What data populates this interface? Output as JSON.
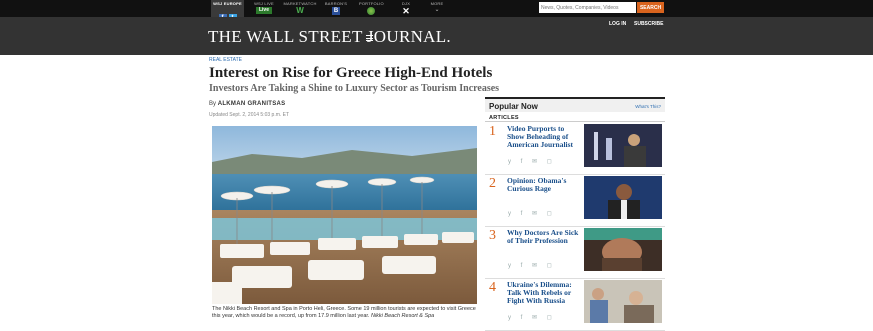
{
  "topnav": {
    "europe_label": "WSJ EUROPE",
    "wsj_live_label": "WSJ LIVE",
    "live_badge": "Live",
    "marketwatch_label": "MARKETWATCH",
    "marketwatch_badge": "W",
    "barrons_label": "BARRON'S",
    "barrons_badge": "B",
    "portfolio_label": "PORTFOLIO",
    "dj_label": "DJX",
    "more_label": "MORE",
    "search_placeholder": "News, Quotes, Companies, Videos",
    "search_button": "SEARCH"
  },
  "masthead": {
    "logo": "THE WALL STREET JOURNAL.",
    "login": "LOG IN",
    "subscribe": "SUBSCRIBE"
  },
  "article": {
    "kicker": "REAL ESTATE",
    "headline": "Interest on Rise for Greece High-End Hotels",
    "subhead": "Investors Are Taking a Shine to Luxury Sector as Tourism Increases",
    "byline_prefix": "By",
    "author": "ALKMAN GRANITSAS",
    "updated": "Updated Sept. 2, 2014 5:03 p.m. ET",
    "caption": "The Nikki Beach Resort and Spa in Porto Heli, Greece. Some 19 million tourists are expected to visit Greece this year, which would be a record, up from 17.9 million last year.",
    "caption_credit": "Nikki Beach Resort & Spa"
  },
  "popular": {
    "title": "Popular Now",
    "whats_this": "What's This?",
    "tab": "ARTICLES",
    "items": [
      {
        "num": "1",
        "text": "Video Purports to Show Beheading of American Journalist"
      },
      {
        "num": "2",
        "text": "Opinion: Obama's Curious Rage"
      },
      {
        "num": "3",
        "text": "Why Doctors Are Sick of Their Profession"
      },
      {
        "num": "4",
        "text": "Ukraine's Dilemma: Talk With Rebels or Fight With Russia"
      }
    ],
    "share_icons": "y f ✉ ◻"
  }
}
